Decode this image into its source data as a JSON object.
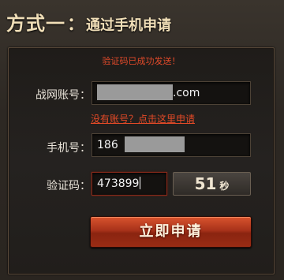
{
  "heading": {
    "main": "方式一",
    "separator": "：",
    "sub": "通过手机申请"
  },
  "notice": "验证码已成功发送！",
  "form": {
    "account": {
      "label": "战网账号：",
      "suffix": ".com"
    },
    "register_link": "没有账号？点击这里申请",
    "phone": {
      "label": "手机号：",
      "prefix": "186"
    },
    "code": {
      "label": "验证码：",
      "value": "473899"
    },
    "countdown": {
      "number": "51",
      "unit": "秒"
    },
    "submit_label": "立即申请"
  },
  "colors": {
    "accent": "#e34a27",
    "button_red": "#a8321a",
    "heading_text": "#f1dfb8"
  }
}
